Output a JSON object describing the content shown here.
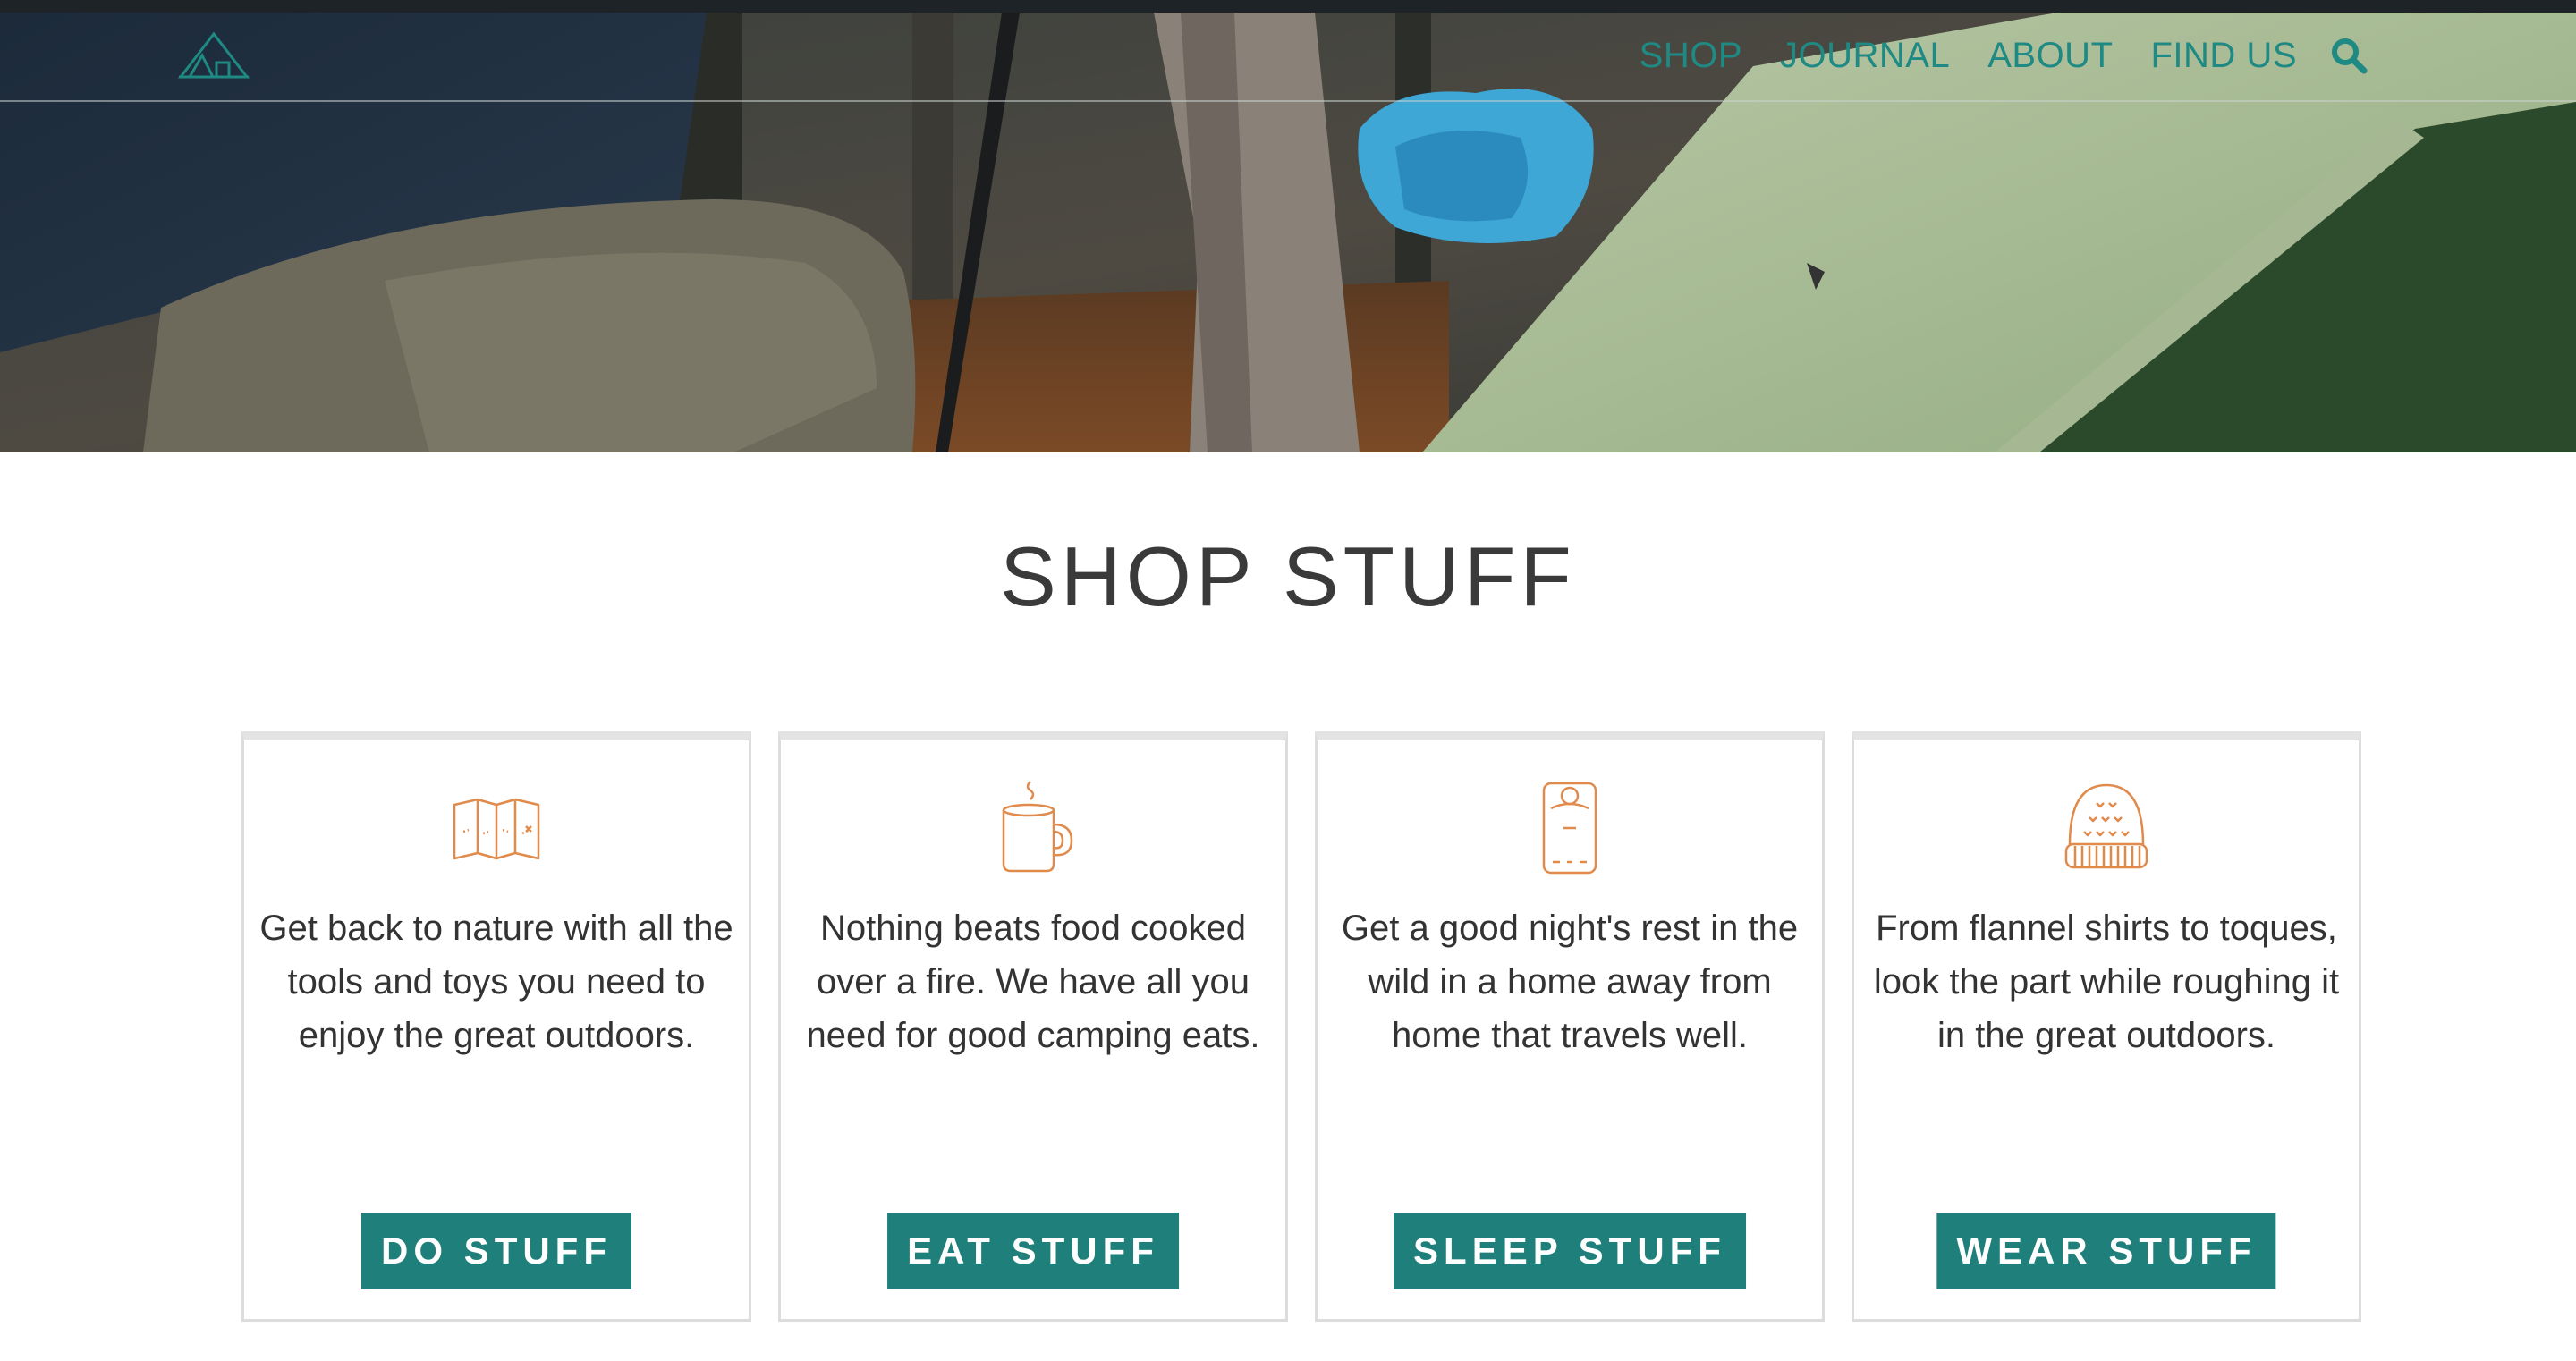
{
  "nav": {
    "links": [
      "SHOP",
      "JOURNAL",
      "ABOUT",
      "FIND US"
    ],
    "search_icon": "search-icon",
    "accent_color": "#1f8a83"
  },
  "main": {
    "title": "SHOP STUFF"
  },
  "cards": [
    {
      "icon": "map-icon",
      "text": "Get back to nature with all the tools and toys you need to enjoy the great outdoors.",
      "button": "DO STUFF"
    },
    {
      "icon": "mug-icon",
      "text": "Nothing beats food cooked over a fire. We have all you need for good camping eats.",
      "button": "EAT STUFF"
    },
    {
      "icon": "sleeping-bag-icon",
      "text": "Get a good night's rest in the wild in a home away from home that travels well.",
      "button": "SLEEP STUFF"
    },
    {
      "icon": "toque-icon",
      "text": "From flannel shirts to toques, look the part while roughing it in the great outdoors.",
      "button": "WEAR STUFF"
    }
  ],
  "colors": {
    "button_bg": "#1f7f7a",
    "icon_orange": "#e08a4c",
    "title_text": "#3a3a3a"
  }
}
